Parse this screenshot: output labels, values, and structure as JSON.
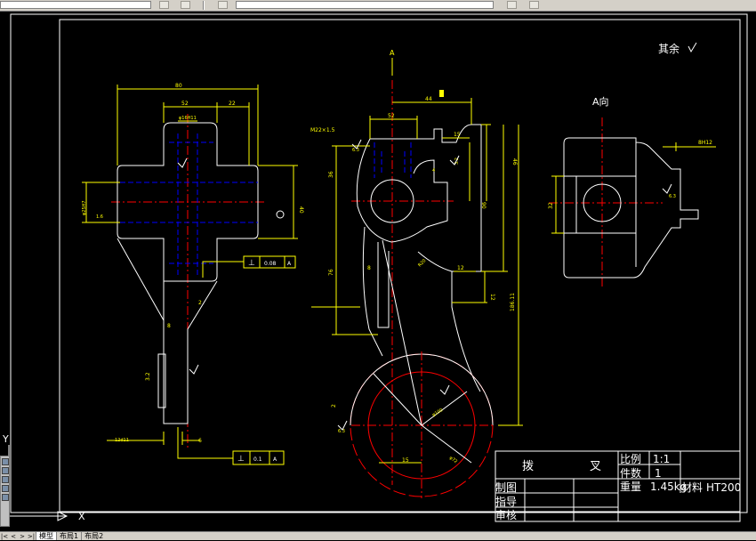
{
  "colors": {
    "background": "#000000",
    "outline": "#ffffff",
    "object": "#ffffff",
    "dimension": "#ffff00",
    "center": "#ff0000",
    "hidden": "#0000ff",
    "section": "#ff0000",
    "text": "#ffffff",
    "annotation": "#ffff00"
  },
  "toolbar": {
    "icons": [
      "layer-icon",
      "properties-icon",
      "refresh-icon",
      "help-icon"
    ]
  },
  "drawing": {
    "roughness_note": "其余",
    "view_label": "A向",
    "section_marks": [
      "A",
      "A"
    ],
    "dims_left": {
      "d80": "80",
      "d52": "52",
      "d22": "22",
      "d16": "φ16H11",
      "d25": "φ25H7",
      "d15": "1.6",
      "d40": "40",
      "d8": "8",
      "d2": "2",
      "d3": "3.2",
      "d12": "12d11",
      "d6": "6"
    },
    "dims_center": {
      "d52": "52",
      "m22": "M22×1.5",
      "d6_3": "6.3",
      "d36": "36",
      "d4": "4",
      "d3_2": "3.2",
      "d44": "44",
      "d15": "15",
      "d46": "46",
      "d90": "90",
      "d76": "76",
      "d8": "8",
      "d20": "R20",
      "d12a": "12",
      "d12b": "12",
      "d186": "186.11",
      "d2": "2",
      "d15b": "15",
      "d6_3b": "6.3",
      "phi": "φ100",
      "phi2": "φ72"
    },
    "dims_right": {
      "d8h12": "8H12",
      "d32": "32",
      "d6_3": "6.3"
    },
    "tolerances": [
      {
        "symbol": "⊥",
        "value": "0.08",
        "datum": "A"
      },
      {
        "symbol": "⊥",
        "value": "0.1",
        "datum": "A"
      }
    ],
    "axis_x": "X",
    "axis_y": "Y"
  },
  "title_block": {
    "part_name_1": "拨",
    "part_name_2": "叉",
    "scale_label": "比例",
    "scale_value": "1:1",
    "qty_label": "件数",
    "qty_value": "1",
    "weight_label": "重量",
    "weight_value": "1.45kg",
    "material_label": "材料",
    "material_value": "HT200",
    "drawn_label": "制图",
    "instructor_label": "指导",
    "review_label": "审核"
  },
  "tabs": {
    "items": [
      "模型",
      "布局1",
      "布局2"
    ]
  }
}
